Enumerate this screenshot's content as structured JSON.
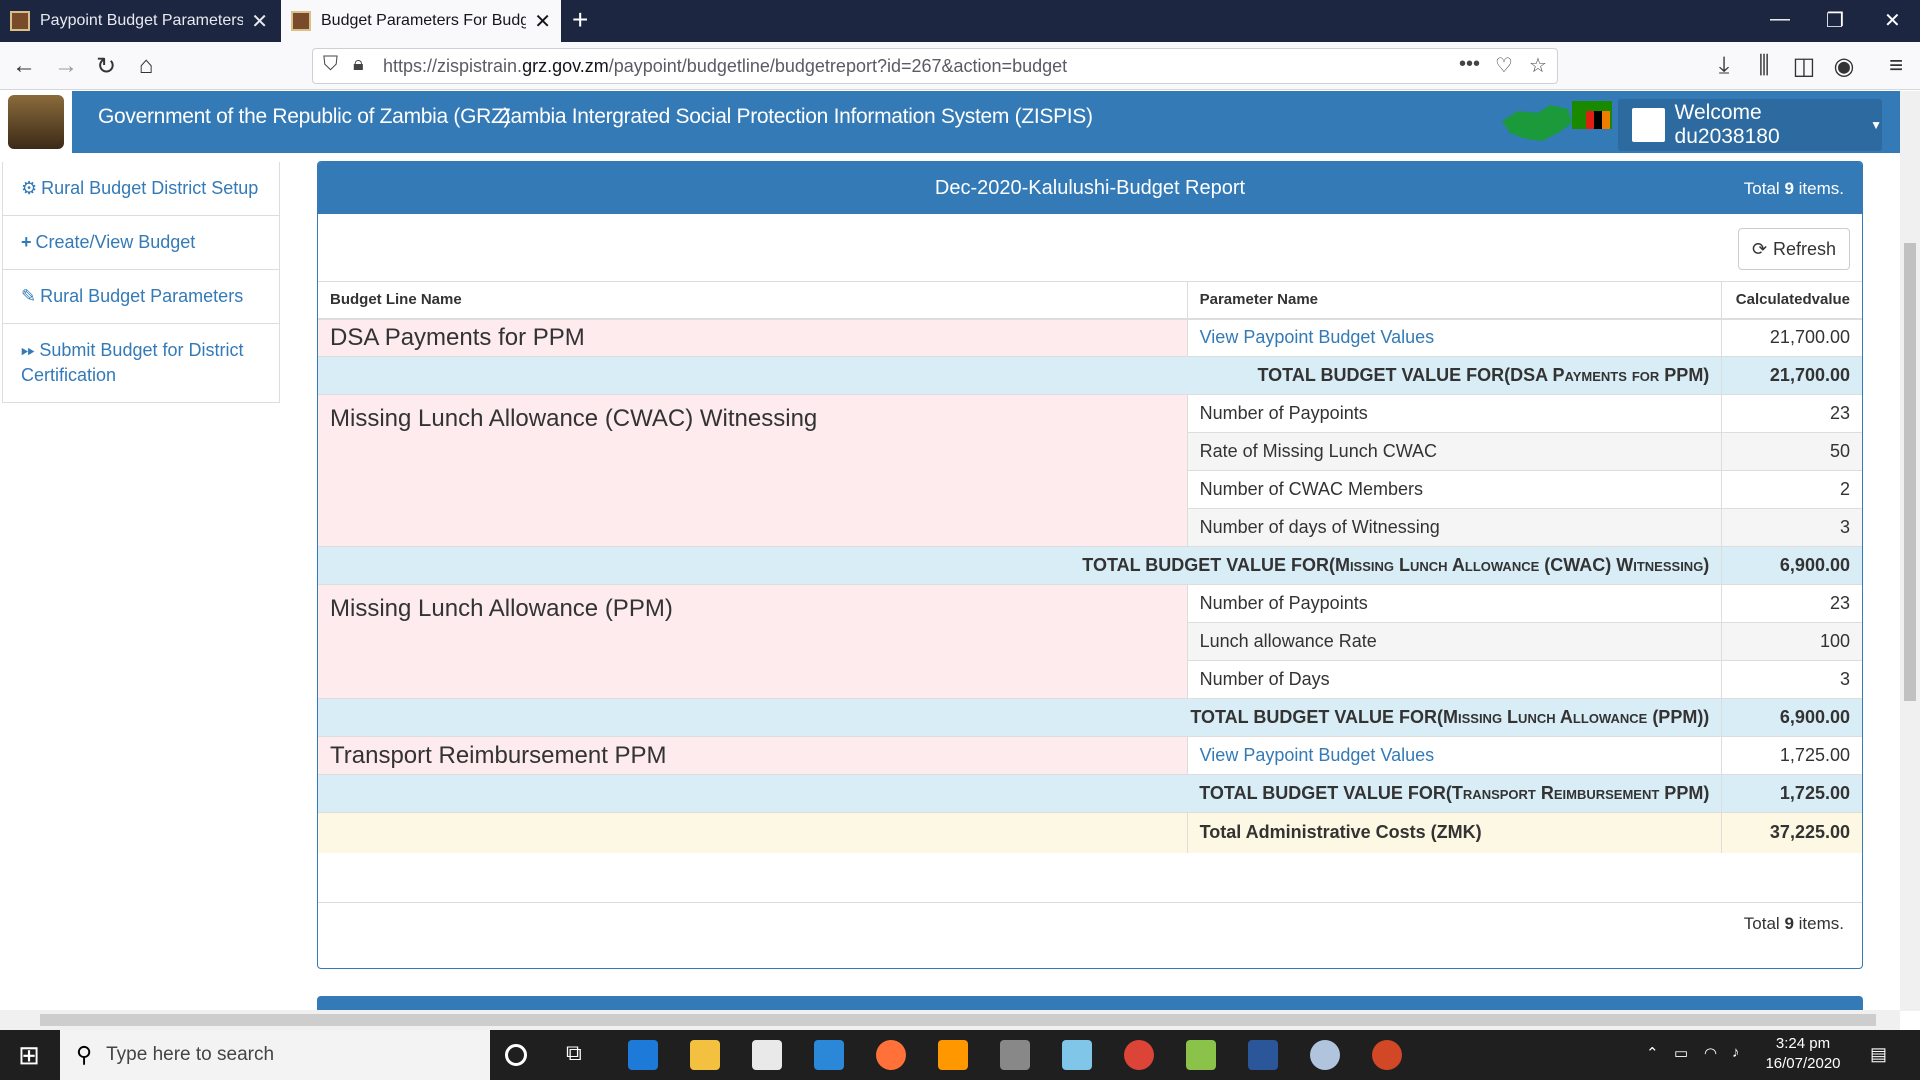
{
  "browser": {
    "tabs": [
      {
        "title": "Paypoint Budget Parameters De"
      },
      {
        "title": "Budget Parameters For Budget"
      }
    ],
    "url_prefix": "https://zispistrain.",
    "url_domain": "grz.gov.zm",
    "url_path": "/paypoint/budgetline/budgetreport?id=267&action=budget"
  },
  "header": {
    "gov_title": "Government of the Republic of Zambia (GRZ)",
    "system_title": "Zambia Intergrated Social Protection Information System (ZISPIS)",
    "welcome": "Welcome du2038180"
  },
  "sidebar": {
    "items": [
      {
        "label": "Rural Budget District Setup",
        "icon": "cogs-icon"
      },
      {
        "label": "Create/View Budget",
        "icon": "plus-icon"
      },
      {
        "label": "Rural Budget Parameters",
        "icon": "eyedropper-icon"
      },
      {
        "label": "Submit Budget for District Certification",
        "icon": "forward-icon"
      }
    ]
  },
  "report": {
    "title": "Dec-2020-Kalulushi-Budget Report",
    "total_prefix": "Total",
    "total_count": "9",
    "total_suffix": "items.",
    "refresh_label": "Refresh",
    "columns": [
      "Budget Line Name",
      "Parameter Name",
      "Calculatedvalue"
    ],
    "link_label": "View Paypoint Budget Values",
    "total_label_prefix": "TOTAL BUDGET VALUE FOR",
    "groups": [
      {
        "name": "DSA Payments for PPM",
        "rows": [
          {
            "param": "View Paypoint Budget Values",
            "value": "21,700.00"
          }
        ],
        "total_name": "(DSA Payments for PPM)",
        "total_value": "21,700.00"
      },
      {
        "name": "Missing Lunch Allowance (CWAC) Witnessing",
        "rows": [
          {
            "param": "Number of Paypoints",
            "value": "23"
          },
          {
            "param": "Rate of Missing Lunch CWAC",
            "value": "50"
          },
          {
            "param": "Number of CWAC Members",
            "value": "2"
          },
          {
            "param": "Number of days of Witnessing",
            "value": "3"
          }
        ],
        "total_name": "(Missing Lunch Allowance (CWAC) Witnessing)",
        "total_value": "6,900.00"
      },
      {
        "name": "Missing Lunch Allowance (PPM)",
        "rows": [
          {
            "param": "Number of Paypoints",
            "value": "23"
          },
          {
            "param": "Lunch allowance Rate",
            "value": "100"
          },
          {
            "param": "Number of Days",
            "value": "3"
          }
        ],
        "total_name": "(Missing Lunch Allowance (PPM))",
        "total_value": "6,900.00"
      },
      {
        "name": "Transport Reimbursement PPM",
        "rows": [
          {
            "param": "View Paypoint Budget Values",
            "value": "1,725.00"
          }
        ],
        "total_name": "(Transport Reimbursement PPM)",
        "total_value": "1,725.00"
      }
    ],
    "grand_total_label": "Total Administrative Costs (ZMK)",
    "grand_total_value": "37,225.00"
  },
  "taskbar": {
    "search_placeholder": "Type here to search",
    "time": "3:24 pm",
    "date": "16/07/2020"
  },
  "colors": {
    "brand": "#337ab7",
    "pink_row": "#fdebee",
    "total_row": "#d9edf7",
    "grand_row": "#fcf8e3"
  }
}
